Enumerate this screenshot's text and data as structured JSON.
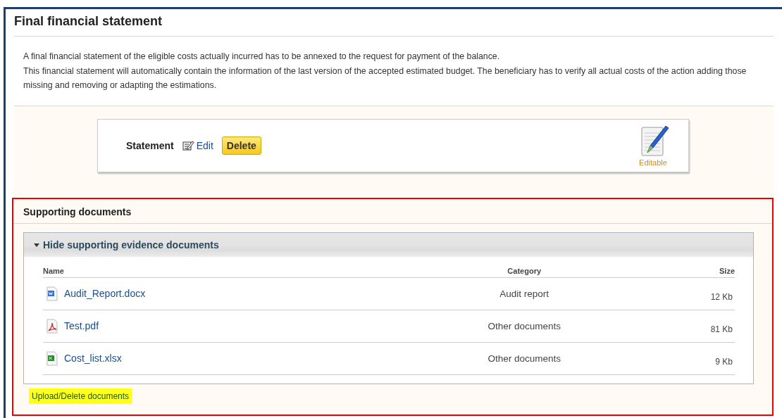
{
  "title": "Final financial statement",
  "intro": [
    "A final financial statement of the eligible costs actually incurred has to be annexed to the request for payment of the balance.",
    "This financial statement will automatically contain the information of the last version of the accepted estimated budget. The beneficiary has to verify all actual costs of the action adding those missing and removing or adapting the estimations."
  ],
  "statement": {
    "label": "Statement",
    "edit": "Edit",
    "delete": "Delete",
    "status": "Editable"
  },
  "supporting": {
    "title": "Supporting documents",
    "toggle": {
      "label": "Hide supporting evidence documents",
      "expanded": true
    },
    "columns": [
      "Name",
      "Category",
      "Size"
    ],
    "rows": [
      {
        "kind": "word",
        "name": "Audit_Report.docx",
        "category": "Audit report",
        "size": "12 Kb"
      },
      {
        "kind": "pdf",
        "name": "Test.pdf",
        "category": "Other documents",
        "size": "81 Kb"
      },
      {
        "kind": "excel",
        "name": "Cost_list.xlsx",
        "category": "Other documents",
        "size": "9 Kb"
      }
    ],
    "upload": "Upload/Delete documents"
  }
}
